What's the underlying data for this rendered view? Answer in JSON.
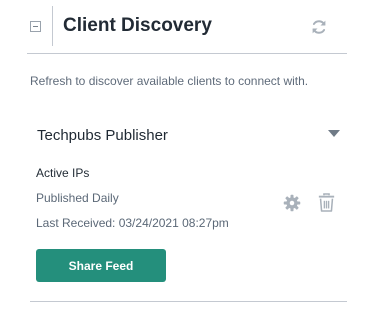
{
  "header": {
    "title": "Client Discovery",
    "collapse_icon": "minus-square-icon",
    "refresh_icon": "refresh-icon"
  },
  "hint_text": "Refresh to discover available clients to connect with.",
  "client": {
    "name": "Techpubs Publisher",
    "expand_icon": "caret-down-icon",
    "active_ips_label": "Active IPs",
    "schedule": "Published Daily",
    "last_received": "Last Received: 03/24/2021 08:27pm",
    "settings_icon": "gear-icon",
    "delete_icon": "trash-icon",
    "share_button_label": "Share Feed"
  },
  "colors": {
    "accent": "#248f7c",
    "icon_gray": "#a9b1ba",
    "divider": "#c4c9d1"
  }
}
